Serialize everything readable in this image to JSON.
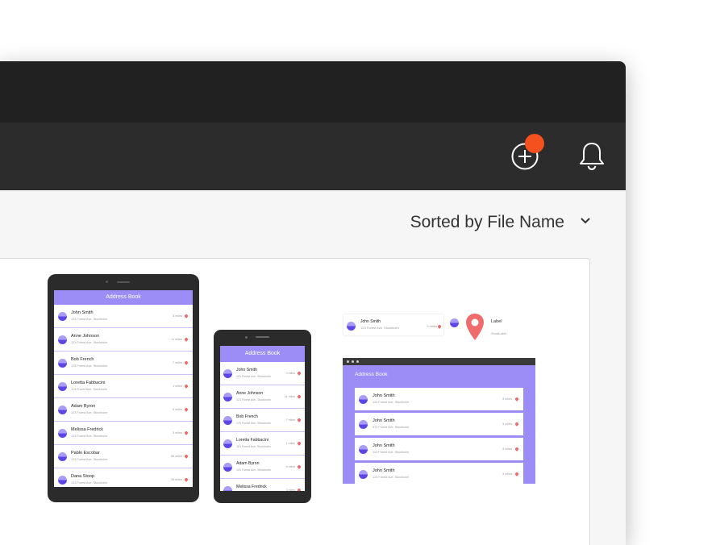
{
  "toolbar": {
    "add_label": "add",
    "notifications_label": "notifications",
    "badge_color": "#f4511e"
  },
  "sort": {
    "label": "Sorted by File Name"
  },
  "preview": {
    "app_title": "Address Book",
    "contacts": [
      {
        "name": "John Smith",
        "address": "123 Forest Ave, Stockholm",
        "distance": "3 miles"
      },
      {
        "name": "Anne Johnson",
        "address": "123 Forest Ave, Stockholm",
        "distance": "11 miles"
      },
      {
        "name": "Bob French",
        "address": "175 Forest Ave, Stockholm",
        "distance": "7 miles"
      },
      {
        "name": "Loretta Fabbacini",
        "address": "113 Forest Ave, Stockholm",
        "distance": "1 miles"
      },
      {
        "name": "Adam Byron",
        "address": "123 Forest Ave, Stockholm",
        "distance": "6 miles"
      },
      {
        "name": "Melissa Fredrick",
        "address": "123 Forest Ave, Stockholm",
        "distance": "3 miles"
      },
      {
        "name": "Pablo Escobar",
        "address": "123 Forest Ave, Stockholm",
        "distance": "88 miles"
      },
      {
        "name": "Dana Stoop",
        "address": "123 Forest Ave, Stockholm",
        "distance": "36 miles"
      }
    ],
    "component": {
      "name": "John Smith",
      "address": "123 Forest Ave, Stockholm",
      "distance": "3 miles",
      "label": "Label",
      "sublabel": "SmallLabel"
    },
    "web_contacts": [
      {
        "name": "John Smith",
        "address": "123 Forest Ave, Stockholm",
        "distance": "3 miles"
      },
      {
        "name": "John Smith",
        "address": "472 Forest Ave, Stockholm",
        "distance": "3 miles"
      },
      {
        "name": "John Smith",
        "address": "123 Forest Ave, Stockholm",
        "distance": "3 miles"
      },
      {
        "name": "John Smith",
        "address": "123 Forest Ave, Stockholm",
        "distance": "3 miles"
      }
    ],
    "accent": "#9c8cf5",
    "pin_color": "#f06b6b"
  }
}
